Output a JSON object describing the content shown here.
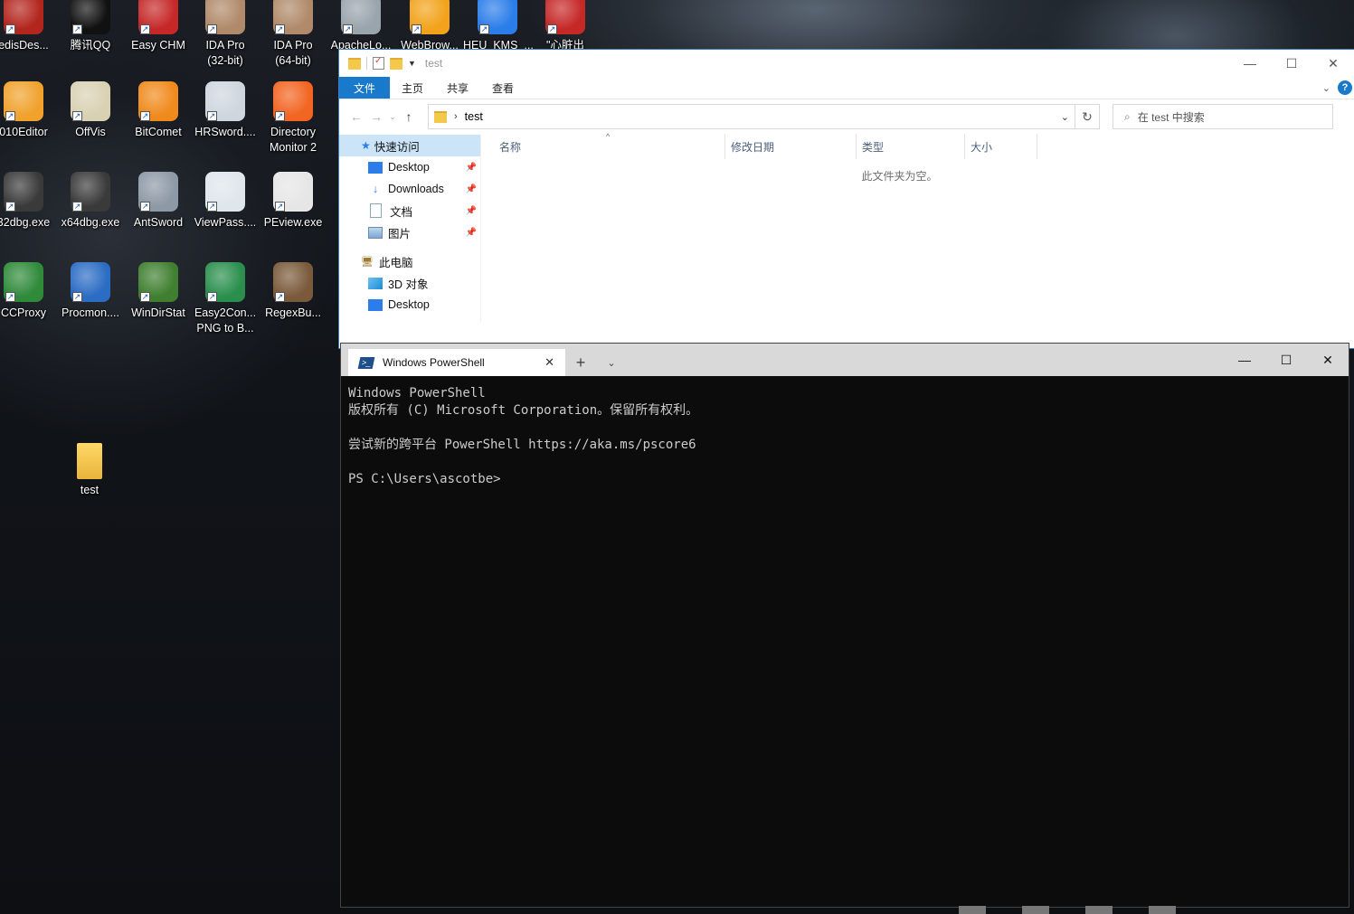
{
  "desktop": {
    "icons": [
      {
        "label": "edisDes...",
        "name": "desktop-icon-redisdesktop",
        "color": "#b3261e"
      },
      {
        "label": "腾讯QQ",
        "name": "desktop-icon-qq",
        "color": "#111111"
      },
      {
        "label": "Easy CHM",
        "name": "desktop-icon-easychm",
        "color": "#c62828"
      },
      {
        "label": "IDA Pro\n(32-bit)",
        "name": "desktop-icon-ida32",
        "color": "#b08a6a"
      },
      {
        "label": "IDA Pro\n(64-bit)",
        "name": "desktop-icon-ida64",
        "color": "#b08a6a"
      },
      {
        "label": "ApacheLo...",
        "name": "desktop-icon-apachelog",
        "color": "#9aa4ad"
      },
      {
        "label": "WebBrow...",
        "name": "desktop-icon-webbrowser",
        "color": "#f2a31b"
      },
      {
        "label": "HEU_KMS_...",
        "name": "desktop-icon-heukms",
        "color": "#2b7de9"
      },
      {
        "label": "\"心脏出血\"漏...",
        "name": "desktop-icon-heartbleed",
        "color": "#c62828"
      },
      {
        "label": "010Editor",
        "name": "desktop-icon-010editor",
        "color": "#f0a22d"
      },
      {
        "label": "OffVis",
        "name": "desktop-icon-offvis",
        "color": "#d9d1b3"
      },
      {
        "label": "BitComet",
        "name": "desktop-icon-bitcomet",
        "color": "#f08a1c"
      },
      {
        "label": "HRSword....",
        "name": "desktop-icon-hrsword",
        "color": "#cfd6de"
      },
      {
        "label": "Directory\nMonitor 2",
        "name": "desktop-icon-directorymonitor",
        "color": "#f26522"
      },
      {
        "label": "32dbg.exe",
        "name": "desktop-icon-x32dbg",
        "color": "#3a3a3a"
      },
      {
        "label": "x64dbg.exe",
        "name": "desktop-icon-x64dbg",
        "color": "#3a3a3a"
      },
      {
        "label": "AntSword",
        "name": "desktop-icon-antsword",
        "color": "#8d99a6"
      },
      {
        "label": "ViewPass....",
        "name": "desktop-icon-viewpass",
        "color": "#dfe6ec"
      },
      {
        "label": "PEview.exe",
        "name": "desktop-icon-peview",
        "color": "#e6e6e6"
      },
      {
        "label": "CCProxy",
        "name": "desktop-icon-ccproxy",
        "color": "#2f8a3a"
      },
      {
        "label": "Procmon....",
        "name": "desktop-icon-procmon",
        "color": "#2b6cc4"
      },
      {
        "label": "WinDirStat",
        "name": "desktop-icon-windirstat",
        "color": "#3f7f2f"
      },
      {
        "label": "Easy2Con...\nPNG to B...",
        "name": "desktop-icon-easy2convert",
        "color": "#2a8f4d"
      },
      {
        "label": "RegexBu...",
        "name": "desktop-icon-regexbuddy",
        "color": "#7a5a3a"
      },
      {
        "label": "test",
        "name": "desktop-icon-test-folder",
        "color": "#f4c84a"
      }
    ]
  },
  "explorer": {
    "title": "test",
    "ribbon_tabs": [
      "文件",
      "主页",
      "共享",
      "查看"
    ],
    "address_path": "test",
    "search_placeholder": "在 test 中搜索",
    "nav_items": [
      {
        "label": "快速访问",
        "pinned": false,
        "selected": true
      },
      {
        "label": "Desktop",
        "pinned": true
      },
      {
        "label": "Downloads",
        "pinned": true
      },
      {
        "label": "文档",
        "pinned": true
      },
      {
        "label": "图片",
        "pinned": true
      },
      {
        "label": "此电脑",
        "pinned": false
      },
      {
        "label": "3D 对象",
        "pinned": false
      },
      {
        "label": "Desktop",
        "pinned": false
      }
    ],
    "columns": [
      "名称",
      "修改日期",
      "类型",
      "大小"
    ],
    "empty_message": "此文件夹为空。"
  },
  "terminal": {
    "tab_title": "Windows PowerShell",
    "lines": [
      "Windows PowerShell",
      "版权所有 (C) Microsoft Corporation。保留所有权利。",
      "",
      "尝试新的跨平台 PowerShell https://aka.ms/pscore6",
      "",
      "PS C:\\Users\\ascotbe>"
    ]
  },
  "colors": {
    "ribbon_file_tab": "#1979ca",
    "terminal_bg": "#0c0c0c",
    "terminal_fg": "#cccccc",
    "nav_selected": "#cce4f7"
  }
}
